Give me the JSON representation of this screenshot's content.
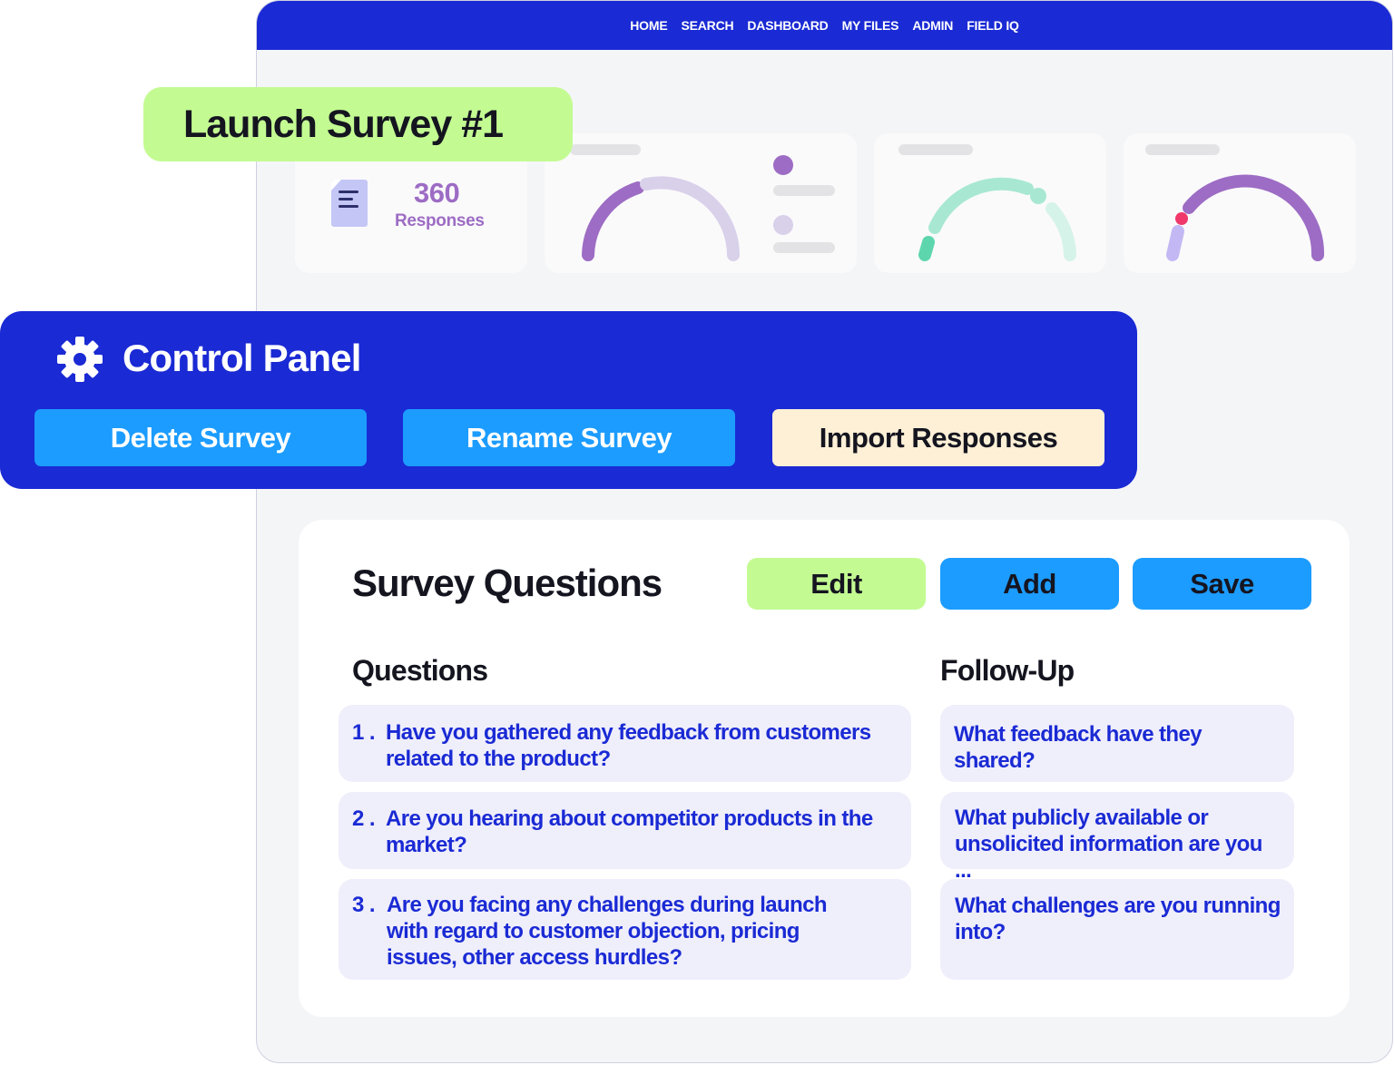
{
  "nav": {
    "items": [
      "HOME",
      "SEARCH",
      "DASHBOARD",
      "MY FILES",
      "ADMIN",
      "FIELD IQ"
    ]
  },
  "launch": {
    "title": "Launch Survey #1"
  },
  "stats": {
    "responses_count": "360",
    "responses_label": "Responses"
  },
  "colors": {
    "primary_blue": "#1a2ad4",
    "button_blue": "#1c9cff",
    "green": "#c3fb92",
    "cream": "#fdf0d6",
    "purple": "#9d6cc4",
    "teal": "#a8e8d2",
    "pink": "#f0396a",
    "question_bg": "#efeefb"
  },
  "control_panel": {
    "title": "Control Panel",
    "icon": "gear-icon",
    "buttons": [
      "Delete Survey",
      "Rename Survey",
      "Import Responses"
    ]
  },
  "survey": {
    "title": "Survey Questions",
    "actions": [
      "Edit",
      "Add",
      "Save"
    ],
    "questions_heading": "Questions",
    "followup_heading": "Follow-Up",
    "questions": [
      {
        "num": "1 .",
        "lines": [
          "Have you gathered any feedback from customers",
          "related to the product?"
        ]
      },
      {
        "num": "2 .",
        "lines": [
          "Are you hearing about competitor products in the",
          "market?"
        ]
      },
      {
        "num": "3 .",
        "lines": [
          "Are you facing any challenges during launch",
          "with regard to customer objection, pricing",
          "issues, other access hurdles?"
        ]
      }
    ],
    "followups": [
      {
        "lines": [
          "What feedback have they",
          "shared?"
        ]
      },
      {
        "lines": [
          "What publicly available or",
          "unsolicited information are you ..."
        ]
      },
      {
        "lines": [
          "What challenges are you running",
          "into?"
        ]
      }
    ]
  }
}
